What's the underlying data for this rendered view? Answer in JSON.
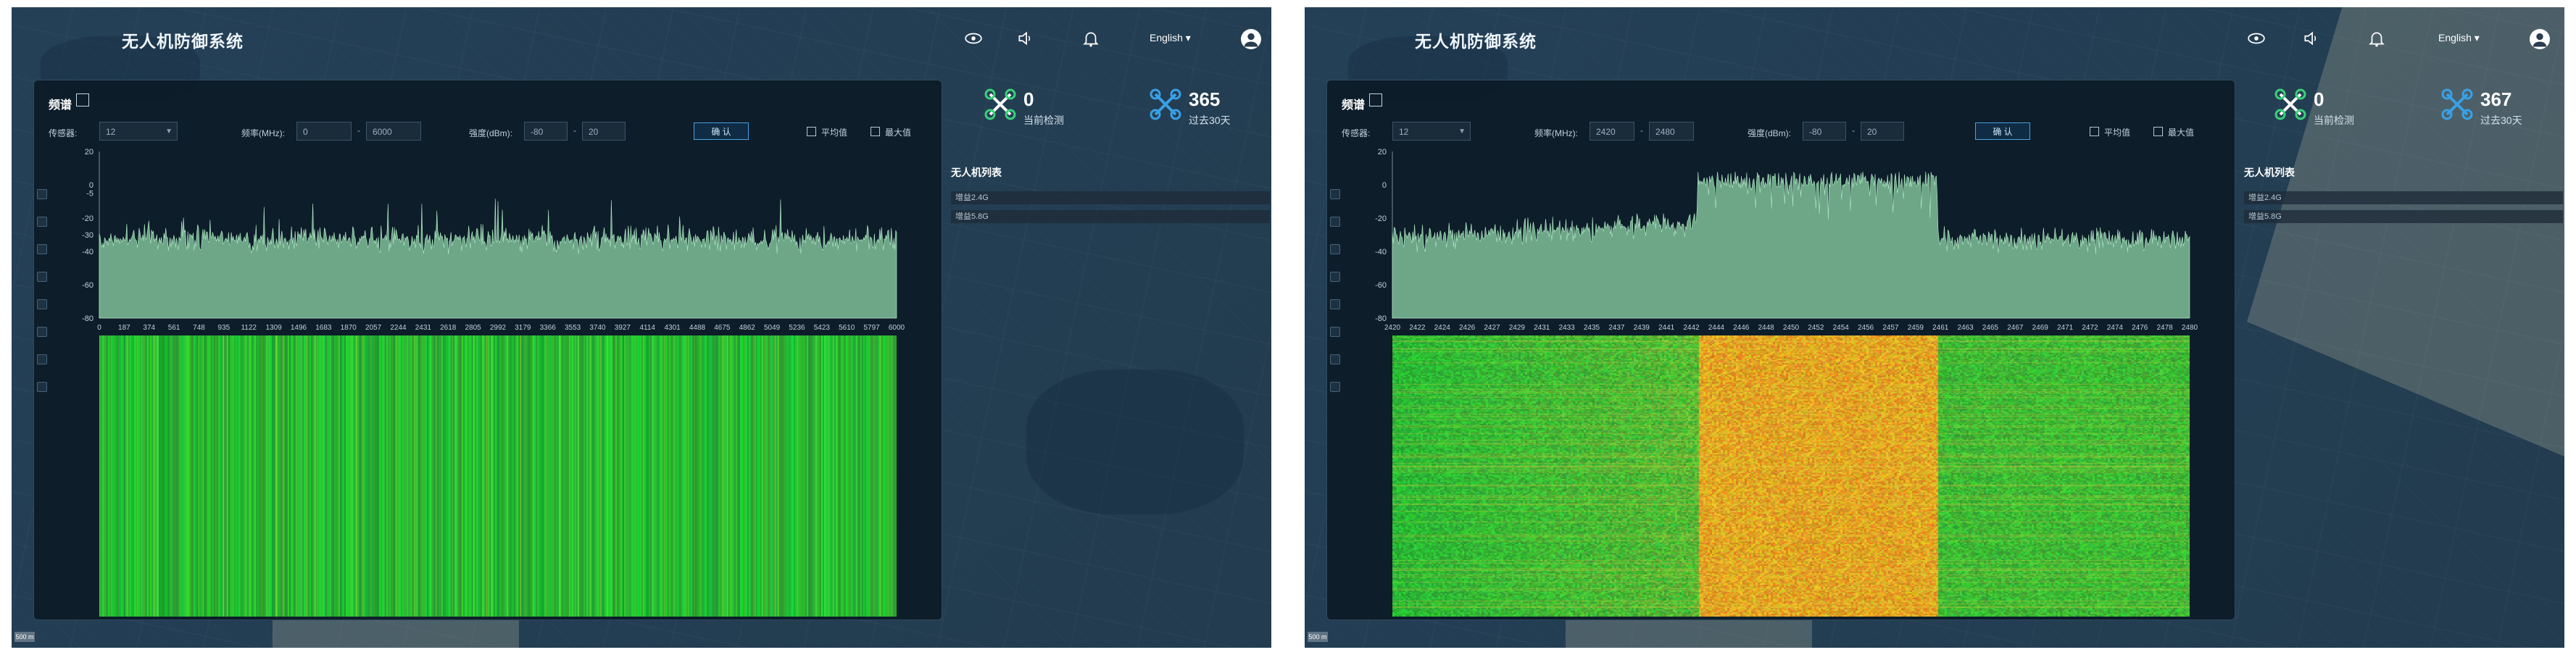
{
  "app_title": "无人机防御系统",
  "language": "English ▾",
  "controls": {
    "panel_title": "频谱",
    "sensor_label": "传感器:",
    "freq_label": "频率(MHz):",
    "strength_label": "强度(dBm):",
    "confirm_label": "确 认",
    "avg_label": "平均值",
    "max_label": "最大值",
    "dash": "-"
  },
  "drone_list": {
    "title": "无人机列表",
    "items": [
      "增益2.4G",
      "增益5.8G"
    ]
  },
  "scale_badge": "500 m",
  "colors": {
    "spectrum_fill": "#8ed6a8",
    "spectrum_line": "#b9f0cc",
    "waterfall_low": "#1fbb3a",
    "waterfall_high": "#e8a21a",
    "accent_blue": "#3aa0e6"
  },
  "screens": [
    {
      "sensor_value": "12",
      "freq_min": "0",
      "freq_max": "6000",
      "strength_min": "-80",
      "strength_max": "20",
      "stats": {
        "current_count": "0",
        "current_caption": "当前检测",
        "past_count": "365",
        "past_caption": "过去30天"
      },
      "chart_data": {
        "type": "area",
        "y_ticks": [
          "20",
          "0",
          "-5",
          "-20",
          "-30",
          "-40",
          "-60",
          "-80"
        ],
        "y_tick_values": [
          20,
          0,
          -5,
          -20,
          -30,
          -40,
          -60,
          -80
        ],
        "ylim": [
          -80,
          20
        ],
        "x_ticks": [
          "0",
          "187",
          "374",
          "561",
          "748",
          "935",
          "1122",
          "1309",
          "1496",
          "1683",
          "1870",
          "2057",
          "2244",
          "2431",
          "2618",
          "2805",
          "2992",
          "3179",
          "3366",
          "3553",
          "3740",
          "3927",
          "4114",
          "4301",
          "4488",
          "4675",
          "4862",
          "5049",
          "5236",
          "5423",
          "5610",
          "5797",
          "6000"
        ],
        "baseline_dbm": -42,
        "noise_peak_dbm": -28,
        "band": null
      }
    },
    {
      "sensor_value": "12",
      "freq_min": "2420",
      "freq_max": "2480",
      "strength_min": "-80",
      "strength_max": "20",
      "stats": {
        "current_count": "0",
        "current_caption": "当前检测",
        "past_count": "367",
        "past_caption": "过去30天"
      },
      "chart_data": {
        "type": "area",
        "y_ticks": [
          "20",
          "0",
          "-20",
          "-40",
          "-60",
          "-80"
        ],
        "y_tick_values": [
          20,
          0,
          -20,
          -40,
          -60,
          -80
        ],
        "ylim": [
          -80,
          20
        ],
        "x_ticks": [
          "2420",
          "2422",
          "2424",
          "2426",
          "2427",
          "2429",
          "2431",
          "2433",
          "2435",
          "2437",
          "2439",
          "2441",
          "2442",
          "2444",
          "2446",
          "2448",
          "2450",
          "2452",
          "2454",
          "2456",
          "2457",
          "2459",
          "2461",
          "2463",
          "2465",
          "2467",
          "2469",
          "2471",
          "2472",
          "2474",
          "2476",
          "2478",
          "2480"
        ],
        "baseline_dbm": -42,
        "noise_peak_dbm": -30,
        "band": {
          "start_mhz": 2443,
          "end_mhz": 2461,
          "level_dbm": 8
        }
      }
    }
  ]
}
